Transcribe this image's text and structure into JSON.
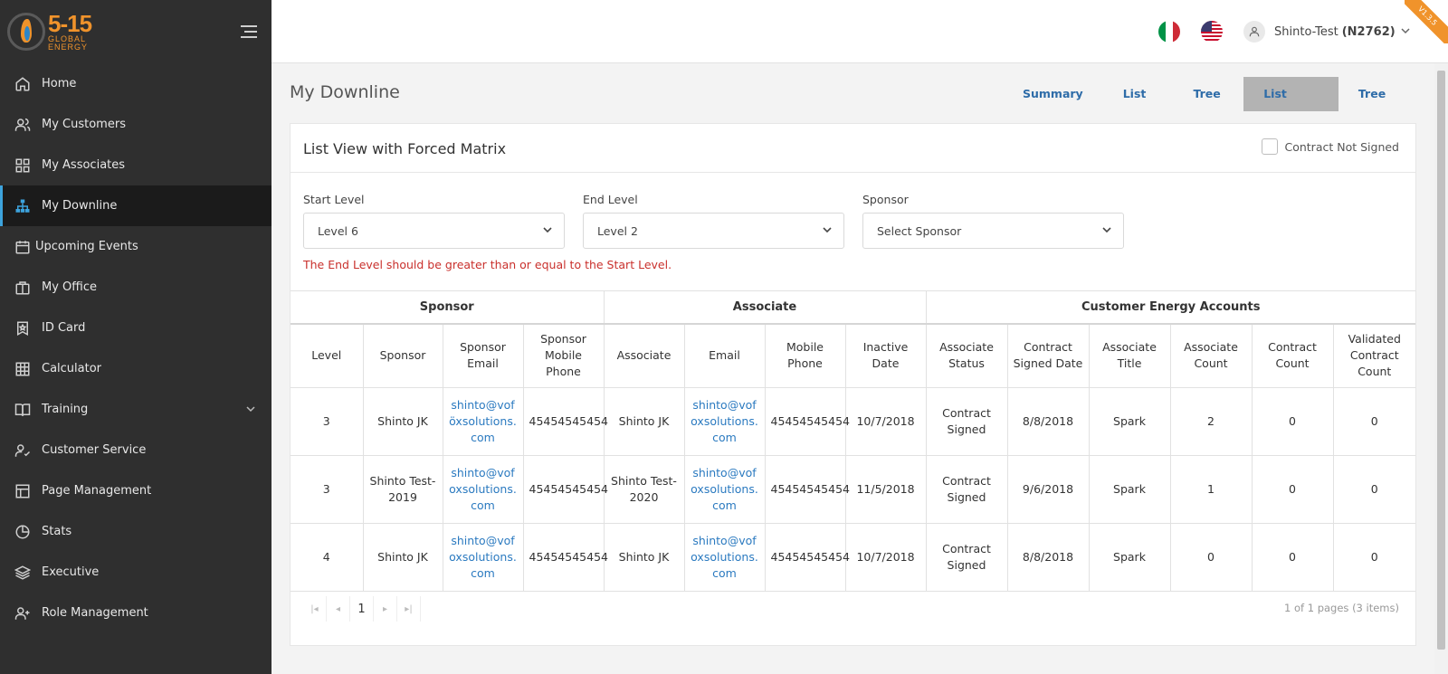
{
  "brand": {
    "logo_main": "5-15",
    "logo_sub1": "GLOBAL",
    "logo_sub2": "ENERGY"
  },
  "sidebar": {
    "items": [
      {
        "label": "Home",
        "icon": "home-icon"
      },
      {
        "label": "My Customers",
        "icon": "users-icon"
      },
      {
        "label": "My Associates",
        "icon": "grid-icon"
      },
      {
        "label": "My Downline",
        "icon": "hierarchy-icon"
      },
      {
        "label": "Upcoming Events",
        "icon": "calendar-icon"
      },
      {
        "label": "My Office",
        "icon": "briefcase-icon"
      },
      {
        "label": "ID Card",
        "icon": "id-badge-icon"
      },
      {
        "label": "Calculator",
        "icon": "calculator-icon"
      },
      {
        "label": "Training",
        "icon": "book-icon"
      },
      {
        "label": "Customer Service",
        "icon": "user-check-icon"
      },
      {
        "label": "Page Management",
        "icon": "layout-icon"
      },
      {
        "label": "Stats",
        "icon": "pie-chart-icon"
      },
      {
        "label": "Executive",
        "icon": "layers-icon"
      },
      {
        "label": "Role Management",
        "icon": "user-plus-icon"
      }
    ],
    "active_index": 3
  },
  "header": {
    "user_name": "Shinto-Test",
    "user_id": "(N2762)",
    "version": "V1.3.5",
    "flags": [
      "italy-flag",
      "usa-flag"
    ]
  },
  "main": {
    "title": "My Downline",
    "tabs": [
      {
        "label": "Summary"
      },
      {
        "label": "List View"
      },
      {
        "label": "Tree View"
      },
      {
        "label": "List View with Forced Matrix"
      },
      {
        "label": "Tree View with Forced Matrix"
      }
    ],
    "active_tab": 3
  },
  "card": {
    "title": "List View with Forced Matrix",
    "contract_not_signed_label": "Contract Not Signed",
    "filters": {
      "start_level": {
        "label": "Start Level",
        "value": "Level 6"
      },
      "end_level": {
        "label": "End Level",
        "value": "Level 2"
      },
      "sponsor": {
        "label": "Sponsor",
        "value": "Select Sponsor"
      }
    },
    "error": "The End Level should be greater than or equal to the Start Level."
  },
  "table": {
    "groups": [
      "Sponsor",
      "Associate",
      "Customer Energy Accounts"
    ],
    "columns": [
      "Level",
      "Sponsor",
      "Sponsor Email",
      "Sponsor Mobile Phone",
      "Associate",
      "Email",
      "Mobile Phone",
      "Inactive Date",
      "Associate Status",
      "Contract Signed Date",
      "Associate Title",
      "Associate Count",
      "Contract Count",
      "Validated Contract Count"
    ],
    "rows": [
      [
        "3",
        "Shinto JK",
        "shinto@voföxsolutions.com",
        "45454545454",
        "Shinto JK",
        "shinto@vofoxsolutions.com",
        "45454545454",
        "10/7/2018",
        "Contract Signed",
        "8/8/2018",
        "Spark",
        "2",
        "0",
        "0"
      ],
      [
        "3",
        "Shinto Test-2019",
        "shinto@vofoxsolutions.com",
        "45454545454",
        "Shinto Test-2020",
        "shinto@vofoxsolutions.com",
        "45454545454",
        "11/5/2018",
        "Contract Signed",
        "9/6/2018",
        "Spark",
        "1",
        "0",
        "0"
      ],
      [
        "4",
        "Shinto JK",
        "shinto@vofoxsolutions.com",
        "45454545454",
        "Shinto JK",
        "shinto@vofoxsolutions.com",
        "45454545454",
        "10/7/2018",
        "Contract Signed",
        "8/8/2018",
        "Spark",
        "0",
        "0",
        "0"
      ]
    ]
  },
  "pager": {
    "current_page": "1",
    "info": "1 of 1 pages (3 items)"
  },
  "colors": {
    "sidebar_bg": "#2f2f2f",
    "accent": "#3da3dd",
    "brand_orange": "#f0932b",
    "link": "#2b7ac0",
    "error": "#c9302c"
  }
}
